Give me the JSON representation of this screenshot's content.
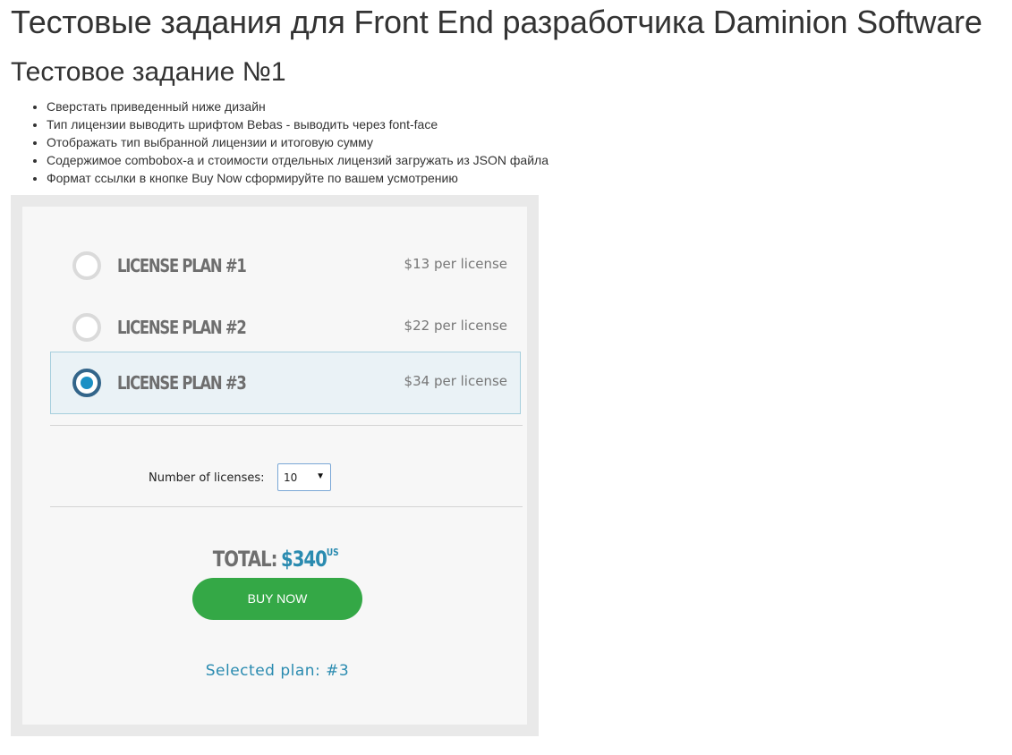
{
  "page": {
    "title": "Тестовые задания для Front End разработчика Daminion Software",
    "task_title": "Тестовое задание №1",
    "requirements": [
      "Сверстать приведенный ниже дизайн",
      "Тип лицензии выводить шрифтом Bebas - выводить через font-face",
      "Отображать тип выбранной лицензии и итоговую сумму",
      "Содержимое combobox-a и стоимости отдельных лицензий загружать из JSON файла",
      "Формат ссылки в кнопке Buy Now сформируйте по вашем усмотрению"
    ]
  },
  "widget": {
    "plans": [
      {
        "name": "License plan #1",
        "price": "$13 per license",
        "selected": false
      },
      {
        "name": "License plan #2",
        "price": "$22 per license",
        "selected": false
      },
      {
        "name": "License plan #3",
        "price": "$34 per license",
        "selected": true
      }
    ],
    "licenses_label": "Number of licenses:",
    "licenses_value": "10",
    "total_label": "TOTAL:",
    "total_amount": "$340",
    "total_currency": "US",
    "buy_label": "BUY NOW",
    "selected_plan_text": "Selected plan: #3"
  },
  "colors": {
    "accent_blue": "#2a8bb0",
    "buy_green": "#34a846",
    "selected_row_bg": "#eaf2f6"
  }
}
